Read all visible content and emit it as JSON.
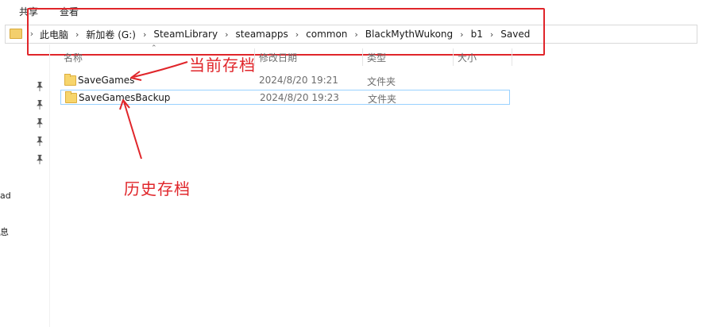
{
  "ribbon": {
    "tabs": [
      "共享",
      "查看"
    ]
  },
  "address_bar": {
    "breadcrumbs": [
      "此电脑",
      "新加卷 (G:)",
      "SteamLibrary",
      "steamapps",
      "common",
      "BlackMythWukong",
      "b1",
      "Saved"
    ]
  },
  "columns": {
    "name": "名称",
    "date": "修改日期",
    "type": "类型",
    "size": "大小"
  },
  "nav": {
    "partial_labels": [
      "ad",
      "‌息"
    ]
  },
  "files": [
    {
      "name": "SaveGames",
      "date": "2024/8/20 19:21",
      "type": "文件夹",
      "selected": false
    },
    {
      "name": "SaveGamesBackup",
      "date": "2024/8/20 19:23",
      "type": "文件夹",
      "selected": true
    }
  ],
  "annotations": {
    "current": "当前存档",
    "history": "历史存档",
    "color": "#e0252a"
  }
}
